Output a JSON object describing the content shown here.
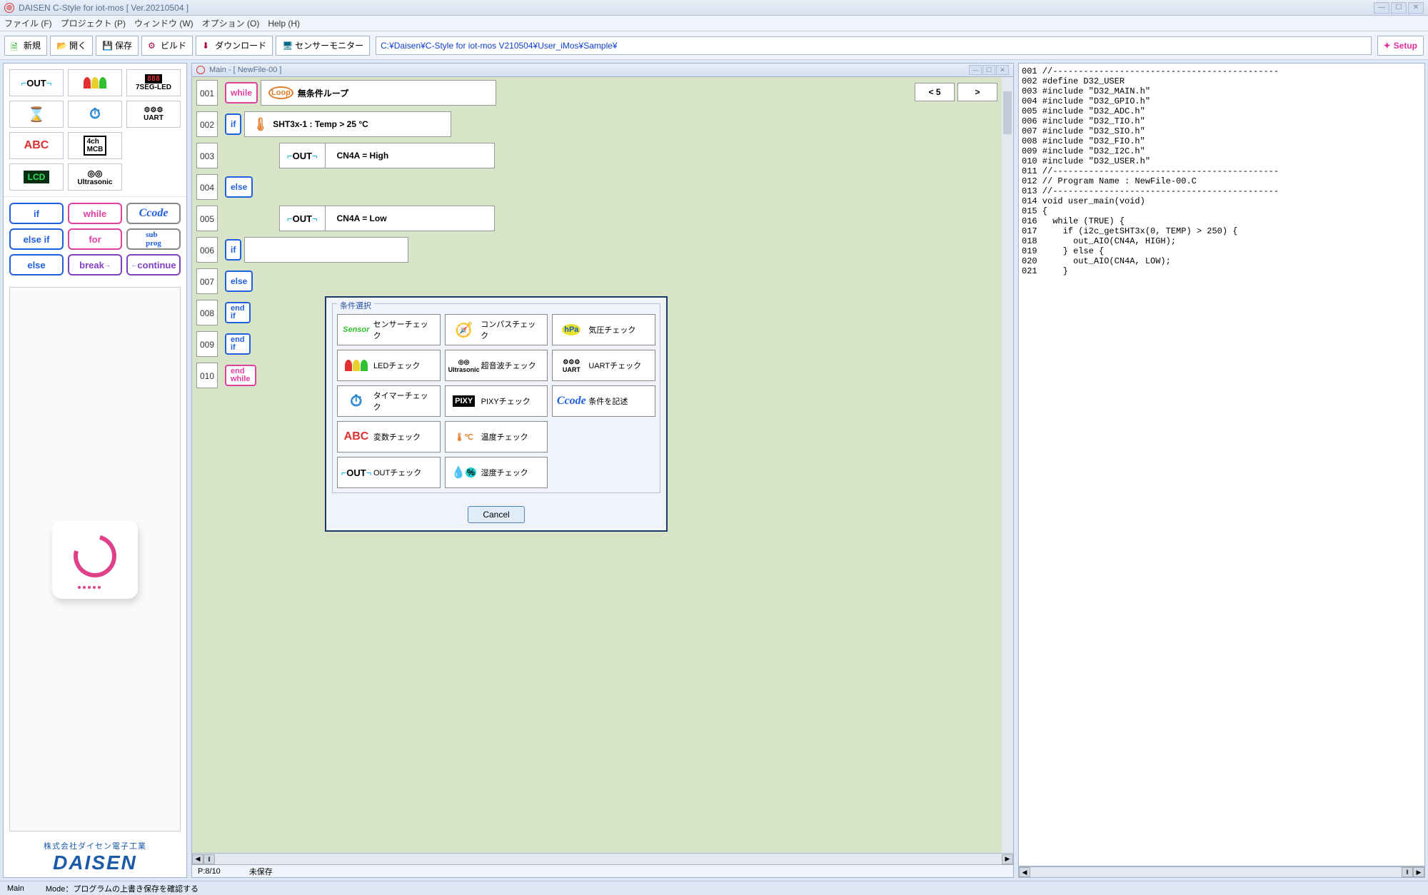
{
  "title": "DAISEN C-Style for iot-mos  [ Ver.20210504 ]",
  "menu": {
    "file": "ファイル (F)",
    "project": "プロジェクト (P)",
    "window": "ウィンドウ (W)",
    "option": "オプション (O)",
    "help": "Help (H)"
  },
  "toolbar": {
    "new": "新規",
    "open": "開く",
    "save": "保存",
    "build": "ビルド",
    "download": "ダウンロード",
    "sensor": "センサーモニター",
    "path": "C:¥Daisen¥C-Style for iot-mos V210504¥User_iMos¥Sample¥",
    "setup": "Setup"
  },
  "palette": {
    "out": "OUT",
    "seg": "7SEG-LED",
    "uart": "UART",
    "abc": "ABC",
    "mcb": "4ch\nMCB",
    "lcd": "LCD",
    "us": "Ultrasonic",
    "if": "if",
    "while": "while",
    "ccode": "Ccode",
    "elseif": "else if",
    "for": "for",
    "sub": "sub\nprog",
    "else": "else",
    "break": "break",
    "continue": "continue"
  },
  "subtitle": "Main - [ NewFile-00 ]",
  "nav": {
    "back": "< 5",
    "fwd": ">"
  },
  "flow": {
    "l001": "001",
    "l002": "002",
    "l003": "003",
    "l004": "004",
    "l005": "005",
    "l006": "006",
    "l007": "007",
    "l008": "008",
    "l009": "009",
    "l010": "010",
    "while": "while",
    "loop": "Loop",
    "loop_text": "無条件ループ",
    "if": "if",
    "if_text": "SHT3x-1 : Temp >  25 °C",
    "out": "OUT",
    "out1": "CN4A = High",
    "out2": "CN4A = Low",
    "else": "else",
    "if2": "if",
    "else2": "else",
    "endif": "end\nif",
    "endif2": "end\nif",
    "endwhile": "end\nwhile"
  },
  "code": "001 //--------------------------------------------\n002 #define D32_USER\n003 #include \"D32_MAIN.h\"\n004 #include \"D32_GPIO.h\"\n005 #include \"D32_ADC.h\"\n006 #include \"D32_TIO.h\"\n007 #include \"D32_SIO.h\"\n008 #include \"D32_FIO.h\"\n009 #include \"D32_I2C.h\"\n010 #include \"D32_USER.h\"\n011 //--------------------------------------------\n012 // Program Name : NewFile-00.C\n013 //--------------------------------------------\n014 void user_main(void)\n015 {\n016   while (TRUE) {\n017     if (i2c_getSHT3x(0, TEMP) > 250) {\n018       out_AIO(CN4A, HIGH);\n019     } else {\n020       out_AIO(CN4A, LOW);\n021     }",
  "status2": {
    "pos": "P:8/10",
    "save": "未保存"
  },
  "brand": {
    "jp": "株式会社ダイセン電子工業",
    "en": "DAISEN"
  },
  "bottom": {
    "tab": "Main",
    "mode": "Mode：プログラムの上書き保存を確認する"
  },
  "dialog": {
    "title": "条件選択",
    "sensor": "センサーチェック",
    "compass": "コンパスチェック",
    "hpa": "気圧チェック",
    "led": "LEDチェック",
    "us": "超音波チェック",
    "uart": "UARTチェック",
    "timer": "タイマーチェック",
    "pixy": "PIXYチェック",
    "ccode": "条件を記述",
    "abc": "変数チェック",
    "temp": "温度チェック",
    "out": "OUTチェック",
    "hum": "湿度チェック",
    "cancel": "Cancel",
    "i_sensor": "Sensor",
    "i_hpa": "hPa",
    "i_uart": "UART",
    "i_us": "Ultrasonic",
    "i_pixy": "PIXY",
    "i_ccode": "Ccode",
    "i_abc": "ABC",
    "i_out": "OUT"
  }
}
